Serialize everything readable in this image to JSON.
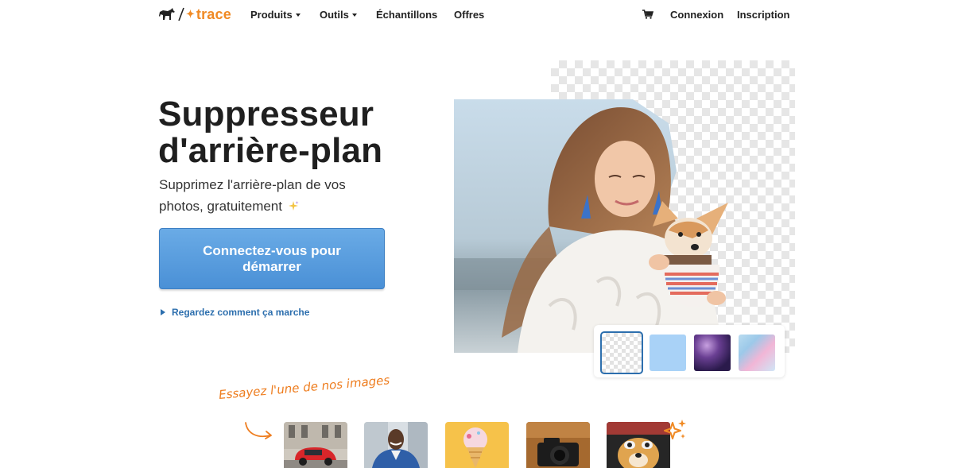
{
  "nav": {
    "logo_text": "trace",
    "menu": [
      {
        "label": "Produits",
        "dropdown": true
      },
      {
        "label": "Outils",
        "dropdown": true
      },
      {
        "label": "Échantillons",
        "dropdown": false
      },
      {
        "label": "Offres",
        "dropdown": false
      }
    ],
    "cart_icon": "cart-icon",
    "login_label": "Connexion",
    "signup_label": "Inscription"
  },
  "hero": {
    "title_line1": "Suppresseur",
    "title_line2": "d'arrière-plan",
    "subtitle_line1": "Supprimez l'arrière-plan de vos",
    "subtitle_line2": "photos, gratuitement",
    "cta_label": "Connectez-vous pour démarrer",
    "how_label": "Regardez comment ça marche"
  },
  "background_swatches": [
    {
      "name": "transparent",
      "selected": true
    },
    {
      "name": "light-blue",
      "color": "#a9d2f7",
      "selected": false
    },
    {
      "name": "galaxy",
      "selected": false
    },
    {
      "name": "pastel-marble",
      "selected": false
    }
  ],
  "samples": {
    "label": "Essayez l'une de nos images",
    "images": [
      "red-car",
      "man-in-suit",
      "ice-cream",
      "camera",
      "dog-with-sunglasses"
    ]
  },
  "colors": {
    "brand_orange": "#f08a24",
    "cta_blue": "#4a90d6",
    "link_blue": "#2d6fae"
  }
}
